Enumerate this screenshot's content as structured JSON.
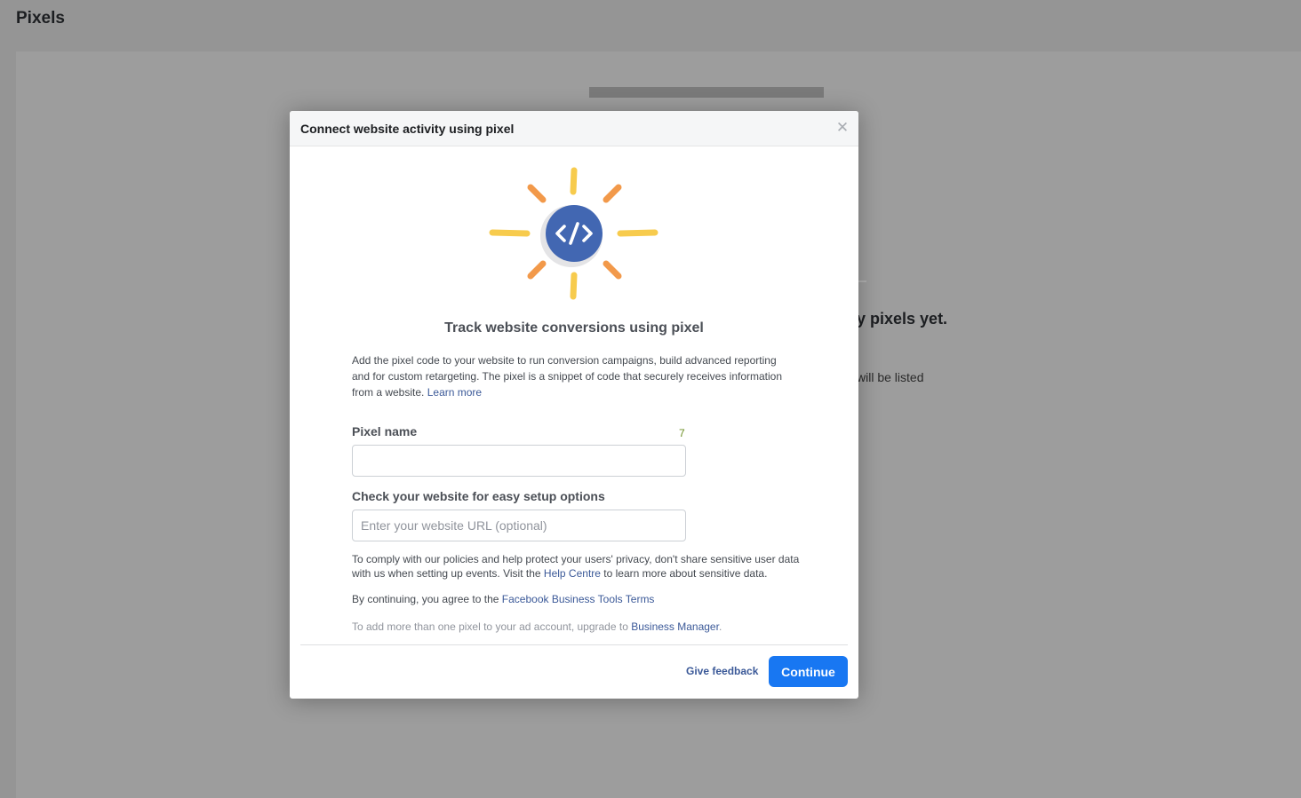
{
  "page": {
    "title": "Pixels",
    "background_empty_title": "y pixels yet.",
    "background_empty_desc": "will be listed"
  },
  "modal": {
    "title": "Connect website activity using pixel",
    "close_icon": "close-icon",
    "illustration_icon": "code-icon",
    "heading": "Track website conversions using pixel",
    "description": "Add the pixel code to your website to run conversion campaigns, build advanced reporting and for custom retargeting. The pixel is a snippet of code that securely receives information from a website.",
    "learn_more": "Learn more",
    "pixel_name": {
      "label": "Pixel name",
      "char_count": "7",
      "value": ""
    },
    "website": {
      "label": "Check your website for easy setup options",
      "placeholder": "Enter your website URL (optional)",
      "value": ""
    },
    "privacy_note": {
      "before": "To comply with our policies and help protect your users' privacy, don't share sensitive user data with us when setting up events. Visit the",
      "link": "Help Centre",
      "after": "to learn more about sensitive data."
    },
    "terms_note": {
      "before": "By continuing, you agree to the",
      "link": "Facebook Business Tools Terms"
    },
    "upgrade_note": {
      "before": "To add more than one pixel to your ad account, upgrade to",
      "link": "Business Manager",
      "after": "."
    },
    "footer": {
      "feedback": "Give feedback",
      "continue": "Continue"
    }
  },
  "colors": {
    "primary_button": "#1877f2",
    "link": "#3b5998",
    "icon_circle": "#4267b2",
    "ray_yellow": "#f7cb4d",
    "ray_orange": "#f2994a",
    "char_count": "#6b8e23"
  }
}
